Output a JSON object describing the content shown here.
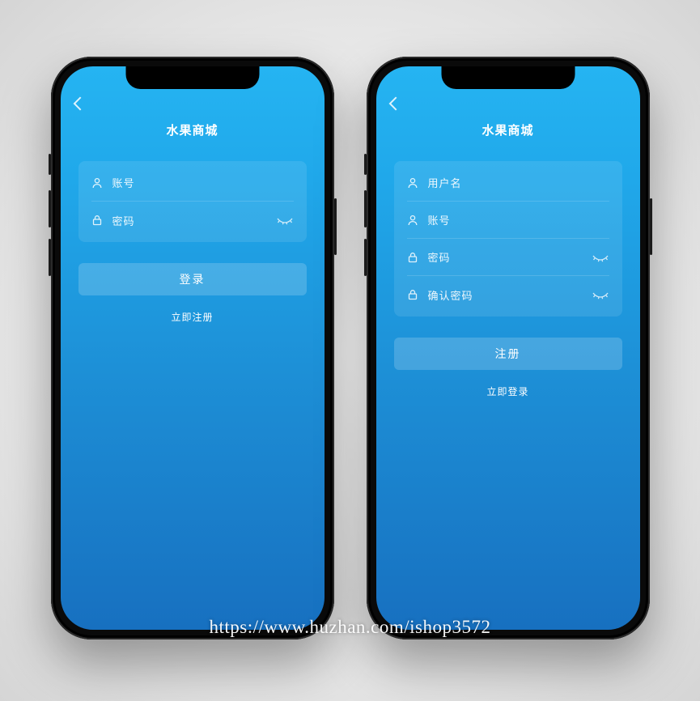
{
  "app_title": "水果商城",
  "login": {
    "fields": {
      "account": "账号",
      "password": "密码"
    },
    "submit": "登录",
    "alt_link": "立即注册"
  },
  "register": {
    "fields": {
      "username": "用户名",
      "account": "账号",
      "password": "密码",
      "confirm": "确认密码"
    },
    "submit": "注册",
    "alt_link": "立即登录"
  },
  "watermark": "https://www.huzhan.com/ishop3572"
}
